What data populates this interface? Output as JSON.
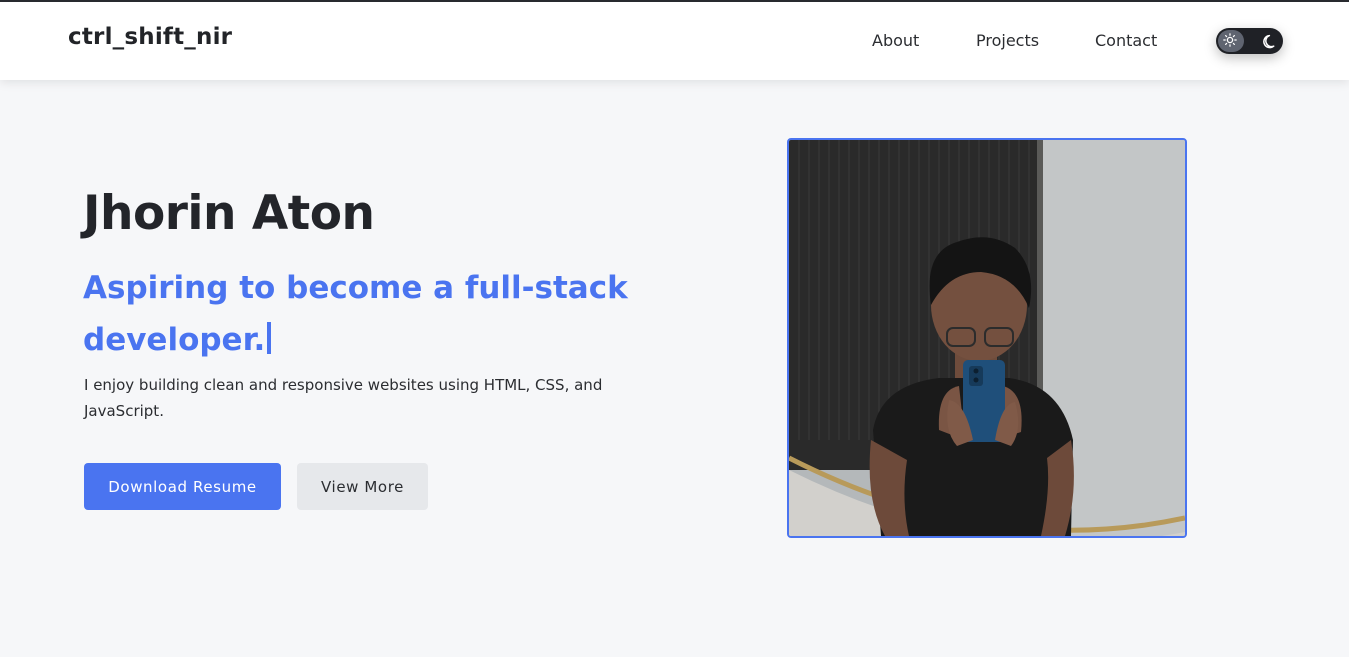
{
  "nav": {
    "brand": "ctrl_shift_nir",
    "links": [
      "About",
      "Projects",
      "Contact"
    ]
  },
  "theme_toggle": {
    "light_icon": "sun-icon",
    "dark_icon": "moon-icon"
  },
  "hero": {
    "name": "Jhorin Aton",
    "tagline": "Aspiring to become a full-stack developer.",
    "description": "I enjoy building clean and responsive websites using HTML, CSS, and JavaScript.",
    "primary_button": "Download Resume",
    "secondary_button": "View More"
  },
  "colors": {
    "accent": "#4a74f0",
    "text": "#23252a",
    "background": "#f6f7f9",
    "secondary_button_bg": "#e6e8eb"
  }
}
